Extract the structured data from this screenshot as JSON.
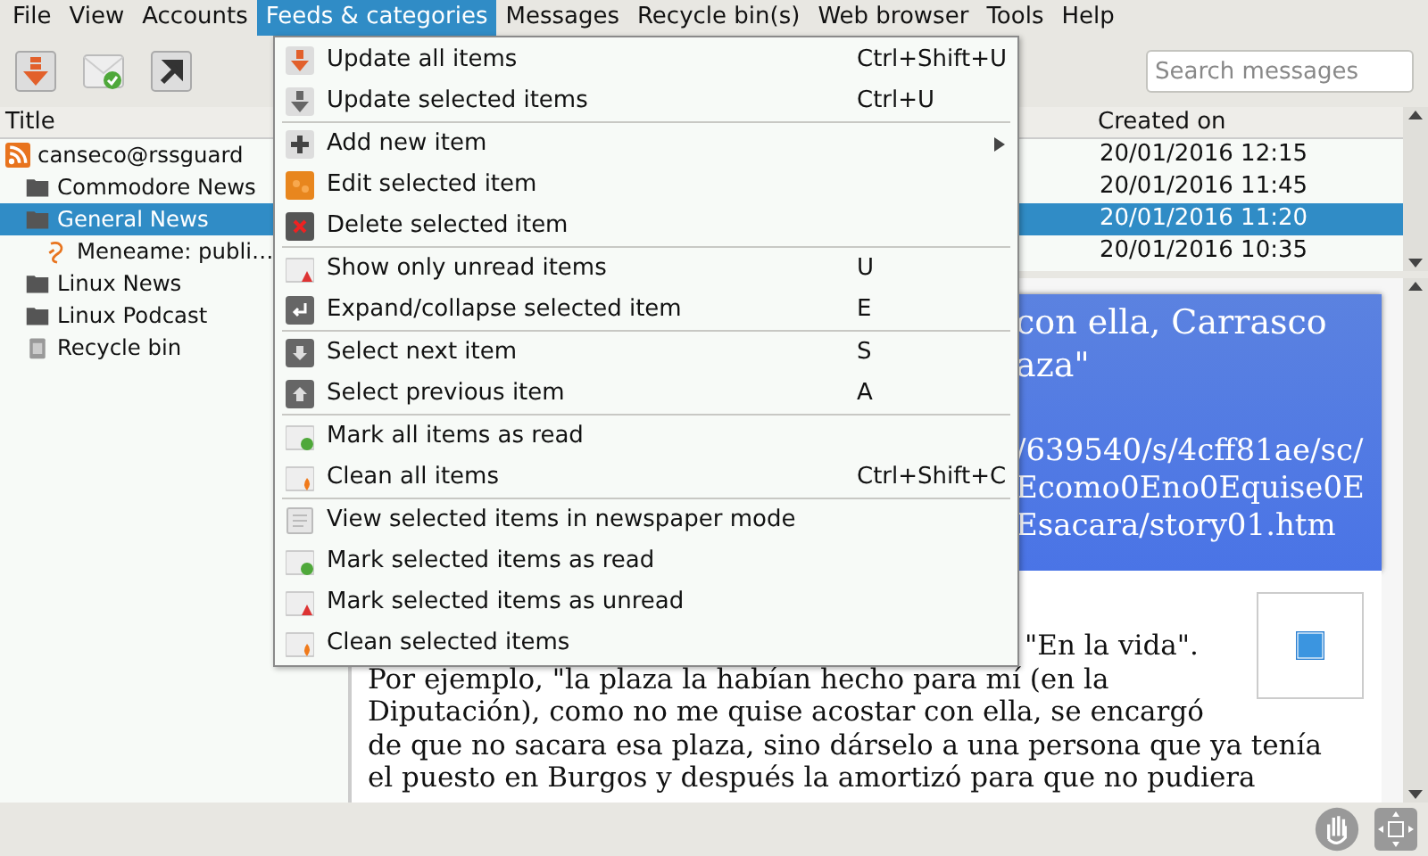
{
  "menu_bar": [
    {
      "label": "File",
      "selected": false
    },
    {
      "label": "View",
      "selected": false
    },
    {
      "label": "Accounts",
      "selected": false
    },
    {
      "label": "Feeds & categories",
      "selected": true
    },
    {
      "label": "Messages",
      "selected": false
    },
    {
      "label": "Recycle bin(s)",
      "selected": false
    },
    {
      "label": "Web browser",
      "selected": false
    },
    {
      "label": "Tools",
      "selected": false
    },
    {
      "label": "Help",
      "selected": false
    }
  ],
  "search": {
    "placeholder": "Search messages"
  },
  "feeds": {
    "header": "Title",
    "items": [
      {
        "label": "canseco@rssguard",
        "selected": false,
        "children": [
          {
            "label": "Commodore News",
            "selected": false
          },
          {
            "label": "General News",
            "selected": true,
            "children": [
              {
                "label": "Meneame: publi…",
                "selected": false
              }
            ]
          },
          {
            "label": "Linux News",
            "selected": false
          },
          {
            "label": "Linux Podcast",
            "selected": false
          },
          {
            "label": "Recycle bin",
            "selected": false
          }
        ]
      }
    ]
  },
  "messages": {
    "column_2": "Created on",
    "rows": [
      {
        "created_on": "20/01/2016 12:15",
        "selected": false
      },
      {
        "created_on": "20/01/2016 11:45",
        "selected": false
      },
      {
        "created_on": "20/01/2016 11:20",
        "selected": true
      },
      {
        "created_on": "20/01/2016 10:35",
        "selected": false
      }
    ]
  },
  "article": {
    "title_lines": [
      "con ella, Carrasco",
      "aza\""
    ],
    "url_lines": [
      "/639540/s/4cff81ae/sc/",
      "Ecomo0Eno0Equise0E",
      "Esacara/story01.htm"
    ],
    "first_line": "\"En la vida\".",
    "body_lines": [
      "Por ejemplo, \"la plaza la habían hecho para mí (en la",
      "Diputación), como no me quise acostar con ella, se encargó",
      "de que no sacara esa plaza, sino dárselo a una persona que ya tenía",
      "el puesto en Burgos y después la amortizó para que no pudiera"
    ]
  },
  "menu": [
    {
      "kind": "item",
      "label": "Update all items",
      "shortcut": "Ctrl+Shift+U"
    },
    {
      "kind": "item",
      "label": "Update selected items",
      "shortcut": "Ctrl+U"
    },
    {
      "kind": "separator"
    },
    {
      "kind": "submenu",
      "label": "Add new item"
    },
    {
      "kind": "item",
      "label": "Edit selected item"
    },
    {
      "kind": "item",
      "label": "Delete selected item"
    },
    {
      "kind": "separator"
    },
    {
      "kind": "item",
      "label": "Show only unread items",
      "shortcut": "U"
    },
    {
      "kind": "item",
      "label": "Expand/collapse selected item",
      "shortcut": "E"
    },
    {
      "kind": "separator"
    },
    {
      "kind": "item",
      "label": "Select next item",
      "shortcut": "S"
    },
    {
      "kind": "item",
      "label": "Select previous item",
      "shortcut": "A"
    },
    {
      "kind": "separator"
    },
    {
      "kind": "item",
      "label": "Mark all items as read"
    },
    {
      "kind": "item",
      "label": "Clean all items",
      "shortcut": "Ctrl+Shift+C"
    },
    {
      "kind": "separator"
    },
    {
      "kind": "item",
      "label": "View selected items in newspaper mode"
    },
    {
      "kind": "item",
      "label": "Mark selected items as read"
    },
    {
      "kind": "item",
      "label": "Mark selected items as unread"
    },
    {
      "kind": "item",
      "label": "Clean selected items"
    }
  ]
}
